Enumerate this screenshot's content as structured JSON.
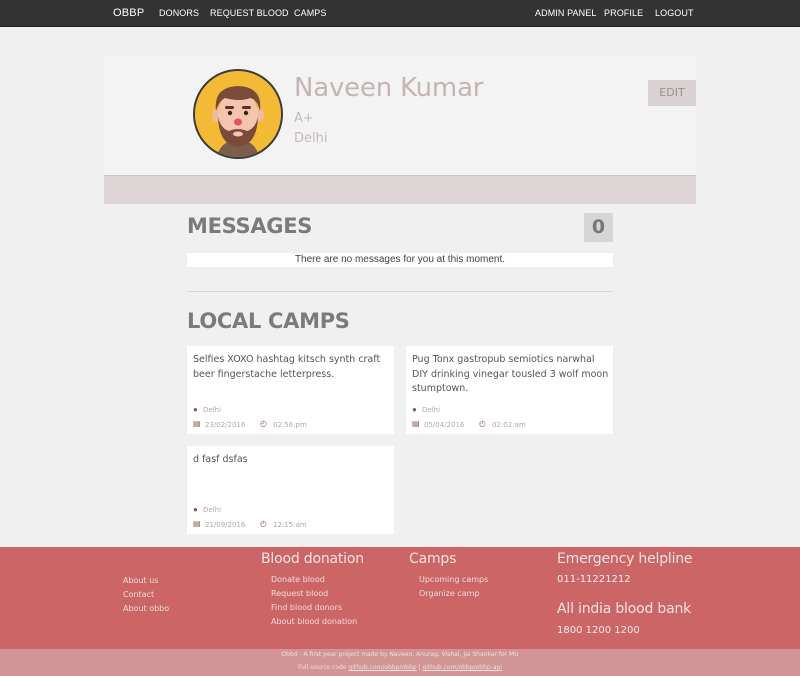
{
  "nav": {
    "brand": "OBBP",
    "left_items": [
      "DONORS",
      "REQUEST BLOOD",
      "CAMPS"
    ],
    "right_items": [
      "ADMIN PANEL",
      "PROFILE",
      "LOGOUT"
    ]
  },
  "profile": {
    "name": "Naveen Kumar",
    "blood_group": "A+",
    "city": "Delhi",
    "edit_label": "EDIT",
    "avatar_icon": "bearded-man-avatar"
  },
  "messages": {
    "title": "MESSAGES",
    "count": "0",
    "empty_text": "There are no messages for you at this moment."
  },
  "camps": {
    "title": "LOCAL CAMPS",
    "items": [
      {
        "desc": "Selfies XOXO hashtag kitsch synth craft beer fingerstache letterpress.",
        "location": "Delhi",
        "date": "23/02/2016",
        "time": "02:56:pm"
      },
      {
        "desc": "Pug Tonx gastropub semiotics narwhal DIY drinking vinegar tousled 3 wolf moon stumptown.",
        "location": "Delhi",
        "date": "05/04/2016",
        "time": "02:02:am"
      },
      {
        "desc": "d fasf dsfas",
        "location": "Delhi",
        "date": "21/09/2016",
        "time": "12:15:am"
      }
    ]
  },
  "footer": {
    "about_links": [
      "About us",
      "Contact",
      "About obbo"
    ],
    "blood_donation": {
      "title": "Blood donation",
      "links": [
        "Donate blood",
        "Request blood",
        "Find blood donors",
        "About blood donation"
      ]
    },
    "camps": {
      "title": "Camps",
      "links": [
        "Upcoming camps",
        "Organize camp"
      ]
    },
    "emergency": {
      "title": "Emergency helpline",
      "number": "011-11221212"
    },
    "bloodbank": {
      "title": "All india blood bank",
      "number": "1800 1200 1200"
    },
    "credit": "Obbd - A first year project made by Naveen, Anurag, Vishal, Jai Shankar for MU",
    "source_prefix": "Full source code",
    "source_link1": "github.com/obbp/obbp",
    "source_sep": " | ",
    "source_link2": "github.com/obbp/obbp-api"
  },
  "colors": {
    "navbar": "#333333",
    "footer": "#cc6666",
    "subfooter": "#d19595",
    "avatar_bg": "#f3bb35"
  }
}
